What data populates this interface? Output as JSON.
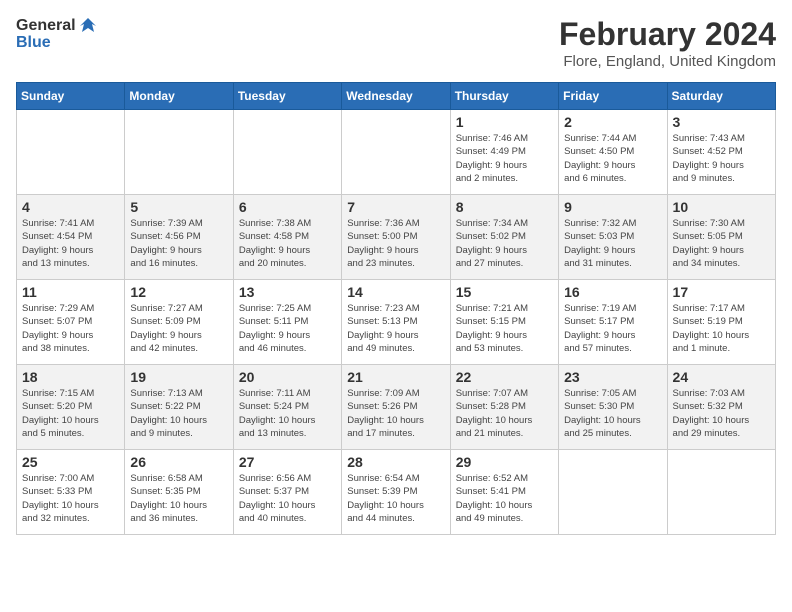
{
  "header": {
    "logo_general": "General",
    "logo_blue": "Blue",
    "main_title": "February 2024",
    "subtitle": "Flore, England, United Kingdom"
  },
  "days_of_week": [
    "Sunday",
    "Monday",
    "Tuesday",
    "Wednesday",
    "Thursday",
    "Friday",
    "Saturday"
  ],
  "weeks": [
    {
      "days": [
        {
          "number": "",
          "info": ""
        },
        {
          "number": "",
          "info": ""
        },
        {
          "number": "",
          "info": ""
        },
        {
          "number": "",
          "info": ""
        },
        {
          "number": "1",
          "info": "Sunrise: 7:46 AM\nSunset: 4:49 PM\nDaylight: 9 hours\nand 2 minutes."
        },
        {
          "number": "2",
          "info": "Sunrise: 7:44 AM\nSunset: 4:50 PM\nDaylight: 9 hours\nand 6 minutes."
        },
        {
          "number": "3",
          "info": "Sunrise: 7:43 AM\nSunset: 4:52 PM\nDaylight: 9 hours\nand 9 minutes."
        }
      ]
    },
    {
      "days": [
        {
          "number": "4",
          "info": "Sunrise: 7:41 AM\nSunset: 4:54 PM\nDaylight: 9 hours\nand 13 minutes."
        },
        {
          "number": "5",
          "info": "Sunrise: 7:39 AM\nSunset: 4:56 PM\nDaylight: 9 hours\nand 16 minutes."
        },
        {
          "number": "6",
          "info": "Sunrise: 7:38 AM\nSunset: 4:58 PM\nDaylight: 9 hours\nand 20 minutes."
        },
        {
          "number": "7",
          "info": "Sunrise: 7:36 AM\nSunset: 5:00 PM\nDaylight: 9 hours\nand 23 minutes."
        },
        {
          "number": "8",
          "info": "Sunrise: 7:34 AM\nSunset: 5:02 PM\nDaylight: 9 hours\nand 27 minutes."
        },
        {
          "number": "9",
          "info": "Sunrise: 7:32 AM\nSunset: 5:03 PM\nDaylight: 9 hours\nand 31 minutes."
        },
        {
          "number": "10",
          "info": "Sunrise: 7:30 AM\nSunset: 5:05 PM\nDaylight: 9 hours\nand 34 minutes."
        }
      ]
    },
    {
      "days": [
        {
          "number": "11",
          "info": "Sunrise: 7:29 AM\nSunset: 5:07 PM\nDaylight: 9 hours\nand 38 minutes."
        },
        {
          "number": "12",
          "info": "Sunrise: 7:27 AM\nSunset: 5:09 PM\nDaylight: 9 hours\nand 42 minutes."
        },
        {
          "number": "13",
          "info": "Sunrise: 7:25 AM\nSunset: 5:11 PM\nDaylight: 9 hours\nand 46 minutes."
        },
        {
          "number": "14",
          "info": "Sunrise: 7:23 AM\nSunset: 5:13 PM\nDaylight: 9 hours\nand 49 minutes."
        },
        {
          "number": "15",
          "info": "Sunrise: 7:21 AM\nSunset: 5:15 PM\nDaylight: 9 hours\nand 53 minutes."
        },
        {
          "number": "16",
          "info": "Sunrise: 7:19 AM\nSunset: 5:17 PM\nDaylight: 9 hours\nand 57 minutes."
        },
        {
          "number": "17",
          "info": "Sunrise: 7:17 AM\nSunset: 5:19 PM\nDaylight: 10 hours\nand 1 minute."
        }
      ]
    },
    {
      "days": [
        {
          "number": "18",
          "info": "Sunrise: 7:15 AM\nSunset: 5:20 PM\nDaylight: 10 hours\nand 5 minutes."
        },
        {
          "number": "19",
          "info": "Sunrise: 7:13 AM\nSunset: 5:22 PM\nDaylight: 10 hours\nand 9 minutes."
        },
        {
          "number": "20",
          "info": "Sunrise: 7:11 AM\nSunset: 5:24 PM\nDaylight: 10 hours\nand 13 minutes."
        },
        {
          "number": "21",
          "info": "Sunrise: 7:09 AM\nSunset: 5:26 PM\nDaylight: 10 hours\nand 17 minutes."
        },
        {
          "number": "22",
          "info": "Sunrise: 7:07 AM\nSunset: 5:28 PM\nDaylight: 10 hours\nand 21 minutes."
        },
        {
          "number": "23",
          "info": "Sunrise: 7:05 AM\nSunset: 5:30 PM\nDaylight: 10 hours\nand 25 minutes."
        },
        {
          "number": "24",
          "info": "Sunrise: 7:03 AM\nSunset: 5:32 PM\nDaylight: 10 hours\nand 29 minutes."
        }
      ]
    },
    {
      "days": [
        {
          "number": "25",
          "info": "Sunrise: 7:00 AM\nSunset: 5:33 PM\nDaylight: 10 hours\nand 32 minutes."
        },
        {
          "number": "26",
          "info": "Sunrise: 6:58 AM\nSunset: 5:35 PM\nDaylight: 10 hours\nand 36 minutes."
        },
        {
          "number": "27",
          "info": "Sunrise: 6:56 AM\nSunset: 5:37 PM\nDaylight: 10 hours\nand 40 minutes."
        },
        {
          "number": "28",
          "info": "Sunrise: 6:54 AM\nSunset: 5:39 PM\nDaylight: 10 hours\nand 44 minutes."
        },
        {
          "number": "29",
          "info": "Sunrise: 6:52 AM\nSunset: 5:41 PM\nDaylight: 10 hours\nand 49 minutes."
        },
        {
          "number": "",
          "info": ""
        },
        {
          "number": "",
          "info": ""
        }
      ]
    }
  ]
}
